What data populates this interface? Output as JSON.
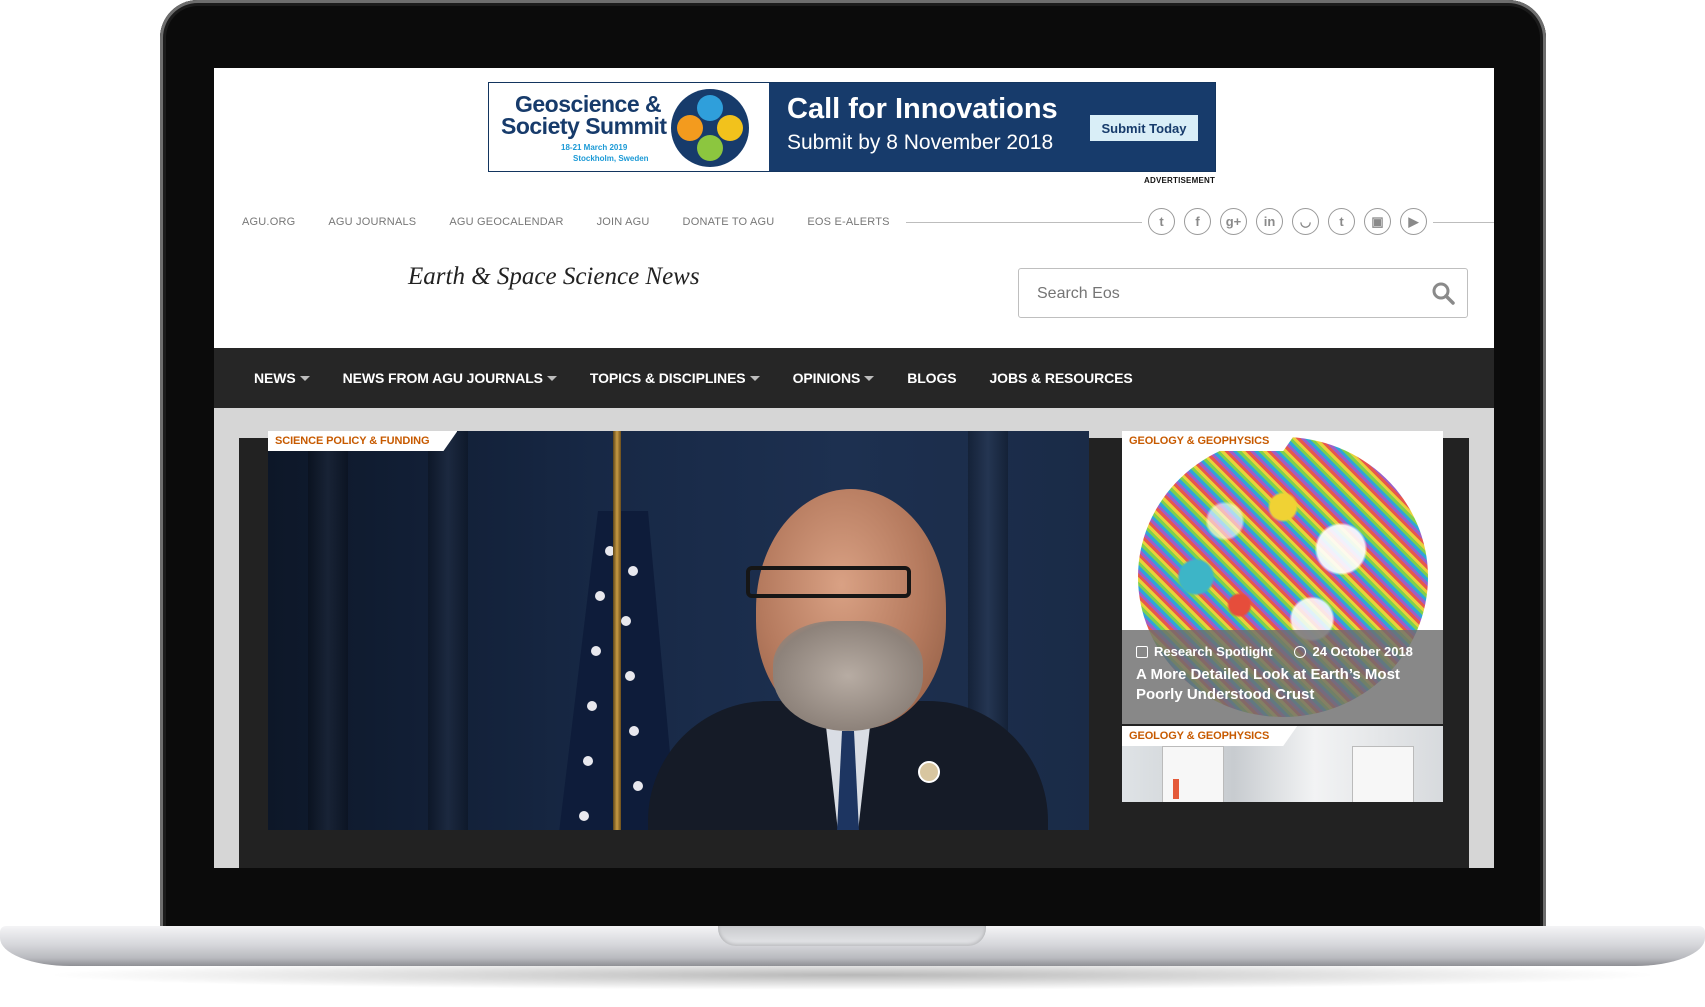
{
  "ad": {
    "title_line1": "Geoscience &",
    "title_line2": "Society Summit",
    "dates": "18-21 March 2019",
    "location": "Stockholm, Sweden",
    "headline": "Call for Innovations",
    "subheadline": "Submit by 8 November 2018",
    "button_label": "Submit Today",
    "label": "ADVERTISEMENT"
  },
  "util_nav": [
    "AGU.ORG",
    "AGU JOURNALS",
    "AGU GEOCALENDAR",
    "JOIN AGU",
    "DONATE TO AGU",
    "EOS E-ALERTS"
  ],
  "social_icons": [
    "twitter-icon",
    "facebook-icon",
    "google-plus-icon",
    "linkedin-icon",
    "rss-icon",
    "tumblr-icon",
    "instagram-icon",
    "youtube-icon"
  ],
  "social_glyphs": [
    "t",
    "f",
    "g+",
    "in",
    "◡",
    "t",
    "▣",
    "▶"
  ],
  "site": {
    "tagline": "Earth & Space Science News"
  },
  "search": {
    "placeholder": "Search Eos"
  },
  "main_nav": [
    {
      "label": "NEWS",
      "dropdown": true
    },
    {
      "label": "NEWS FROM AGU JOURNALS",
      "dropdown": true
    },
    {
      "label": "TOPICS & DISCIPLINES",
      "dropdown": true
    },
    {
      "label": "OPINIONS",
      "dropdown": true
    },
    {
      "label": "BLOGS",
      "dropdown": false
    },
    {
      "label": "JOBS & RESOURCES",
      "dropdown": false
    }
  ],
  "hero": {
    "category": "SCIENCE POLICY & FUNDING"
  },
  "cards": [
    {
      "category": "GEOLOGY & GEOPHYSICS",
      "type": "Research Spotlight",
      "date": "24 October 2018",
      "title": "A More Detailed Look at Earth’s Most Poorly Understood Crust"
    },
    {
      "category": "GEOLOGY & GEOPHYSICS"
    }
  ],
  "colors": {
    "ad_navy": "#173b6b",
    "nav_bg": "#262626",
    "tag_text": "#c75a00"
  }
}
